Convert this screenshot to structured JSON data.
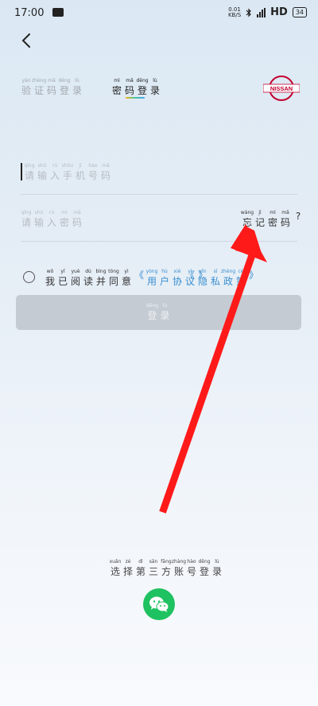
{
  "status_bar": {
    "time": "17:00",
    "net_speed_value": "0.01",
    "net_speed_unit": "KB/S",
    "network_type": "HD",
    "battery": "34",
    "icons": [
      "message-icon",
      "bluetooth-icon",
      "signal-icon",
      "battery-icon"
    ]
  },
  "tabs": {
    "code_login": [
      {
        "py": "yàn",
        "hz": "验"
      },
      {
        "py": "zhèng",
        "hz": "证"
      },
      {
        "py": "mǎ",
        "hz": "码"
      },
      {
        "py": "dēng",
        "hz": "登"
      },
      {
        "py": "lù",
        "hz": "录"
      }
    ],
    "password_login": [
      {
        "py": "mì",
        "hz": "密"
      },
      {
        "py": "mǎ",
        "hz": "码"
      },
      {
        "py": "dēng",
        "hz": "登"
      },
      {
        "py": "lù",
        "hz": "录"
      }
    ]
  },
  "logo_text": "NISSAN",
  "phone_placeholder": [
    {
      "py": "qǐng",
      "hz": "请"
    },
    {
      "py": "shū",
      "hz": "输"
    },
    {
      "py": "rù",
      "hz": "入"
    },
    {
      "py": "shǒu",
      "hz": "手"
    },
    {
      "py": "jī",
      "hz": "机"
    },
    {
      "py": "hào",
      "hz": "号"
    },
    {
      "py": "mǎ",
      "hz": "码"
    }
  ],
  "password_placeholder": [
    {
      "py": "qǐng",
      "hz": "请"
    },
    {
      "py": "shū",
      "hz": "输"
    },
    {
      "py": "rù",
      "hz": "入"
    },
    {
      "py": "mì",
      "hz": "密"
    },
    {
      "py": "mǎ",
      "hz": "码"
    }
  ],
  "forgot_password": [
    {
      "py": "wàng",
      "hz": "忘"
    },
    {
      "py": "jì",
      "hz": "记"
    },
    {
      "py": "mì",
      "hz": "密"
    },
    {
      "py": "mǎ",
      "hz": "码"
    },
    {
      "py": "",
      "hz": "?"
    }
  ],
  "agreement_text": [
    {
      "py": "wǒ",
      "hz": "我"
    },
    {
      "py": "yǐ",
      "hz": "已"
    },
    {
      "py": "yuè",
      "hz": "阅"
    },
    {
      "py": "dú",
      "hz": "读"
    },
    {
      "py": "bìng",
      "hz": "并"
    },
    {
      "py": "tóng",
      "hz": "同"
    },
    {
      "py": "yì",
      "hz": "意"
    }
  ],
  "user_agreement": [
    {
      "py": "",
      "hz": "《"
    },
    {
      "py": "yòng",
      "hz": "用"
    },
    {
      "py": "hù",
      "hz": "户"
    },
    {
      "py": "xié",
      "hz": "协"
    },
    {
      "py": "yì",
      "hz": "议"
    },
    {
      "py": "",
      "hz": "》"
    }
  ],
  "privacy_policy": [
    {
      "py": "",
      "hz": "《"
    },
    {
      "py": "yǐn",
      "hz": "隐"
    },
    {
      "py": "sī",
      "hz": "私"
    },
    {
      "py": "zhèng",
      "hz": "政"
    },
    {
      "py": "cè",
      "hz": "策"
    },
    {
      "py": "",
      "hz": "》"
    }
  ],
  "login_button": [
    {
      "py": "dēng",
      "hz": "登"
    },
    {
      "py": "lù",
      "hz": "录"
    }
  ],
  "third_party_login": [
    {
      "py": "xuǎn",
      "hz": "选"
    },
    {
      "py": "zé",
      "hz": "择"
    },
    {
      "py": "dì",
      "hz": "第"
    },
    {
      "py": "sān",
      "hz": "三"
    },
    {
      "py": "fāng",
      "hz": "方"
    },
    {
      "py": "zhàng",
      "hz": "账"
    },
    {
      "py": "hào",
      "hz": "号"
    },
    {
      "py": "dēng",
      "hz": "登"
    },
    {
      "py": "lù",
      "hz": "录"
    }
  ],
  "colors": {
    "wechat": "#1ec260",
    "link": "#3a8fd0",
    "annotation_arrow": "#ff1a1a",
    "logo": "#c3002f"
  }
}
